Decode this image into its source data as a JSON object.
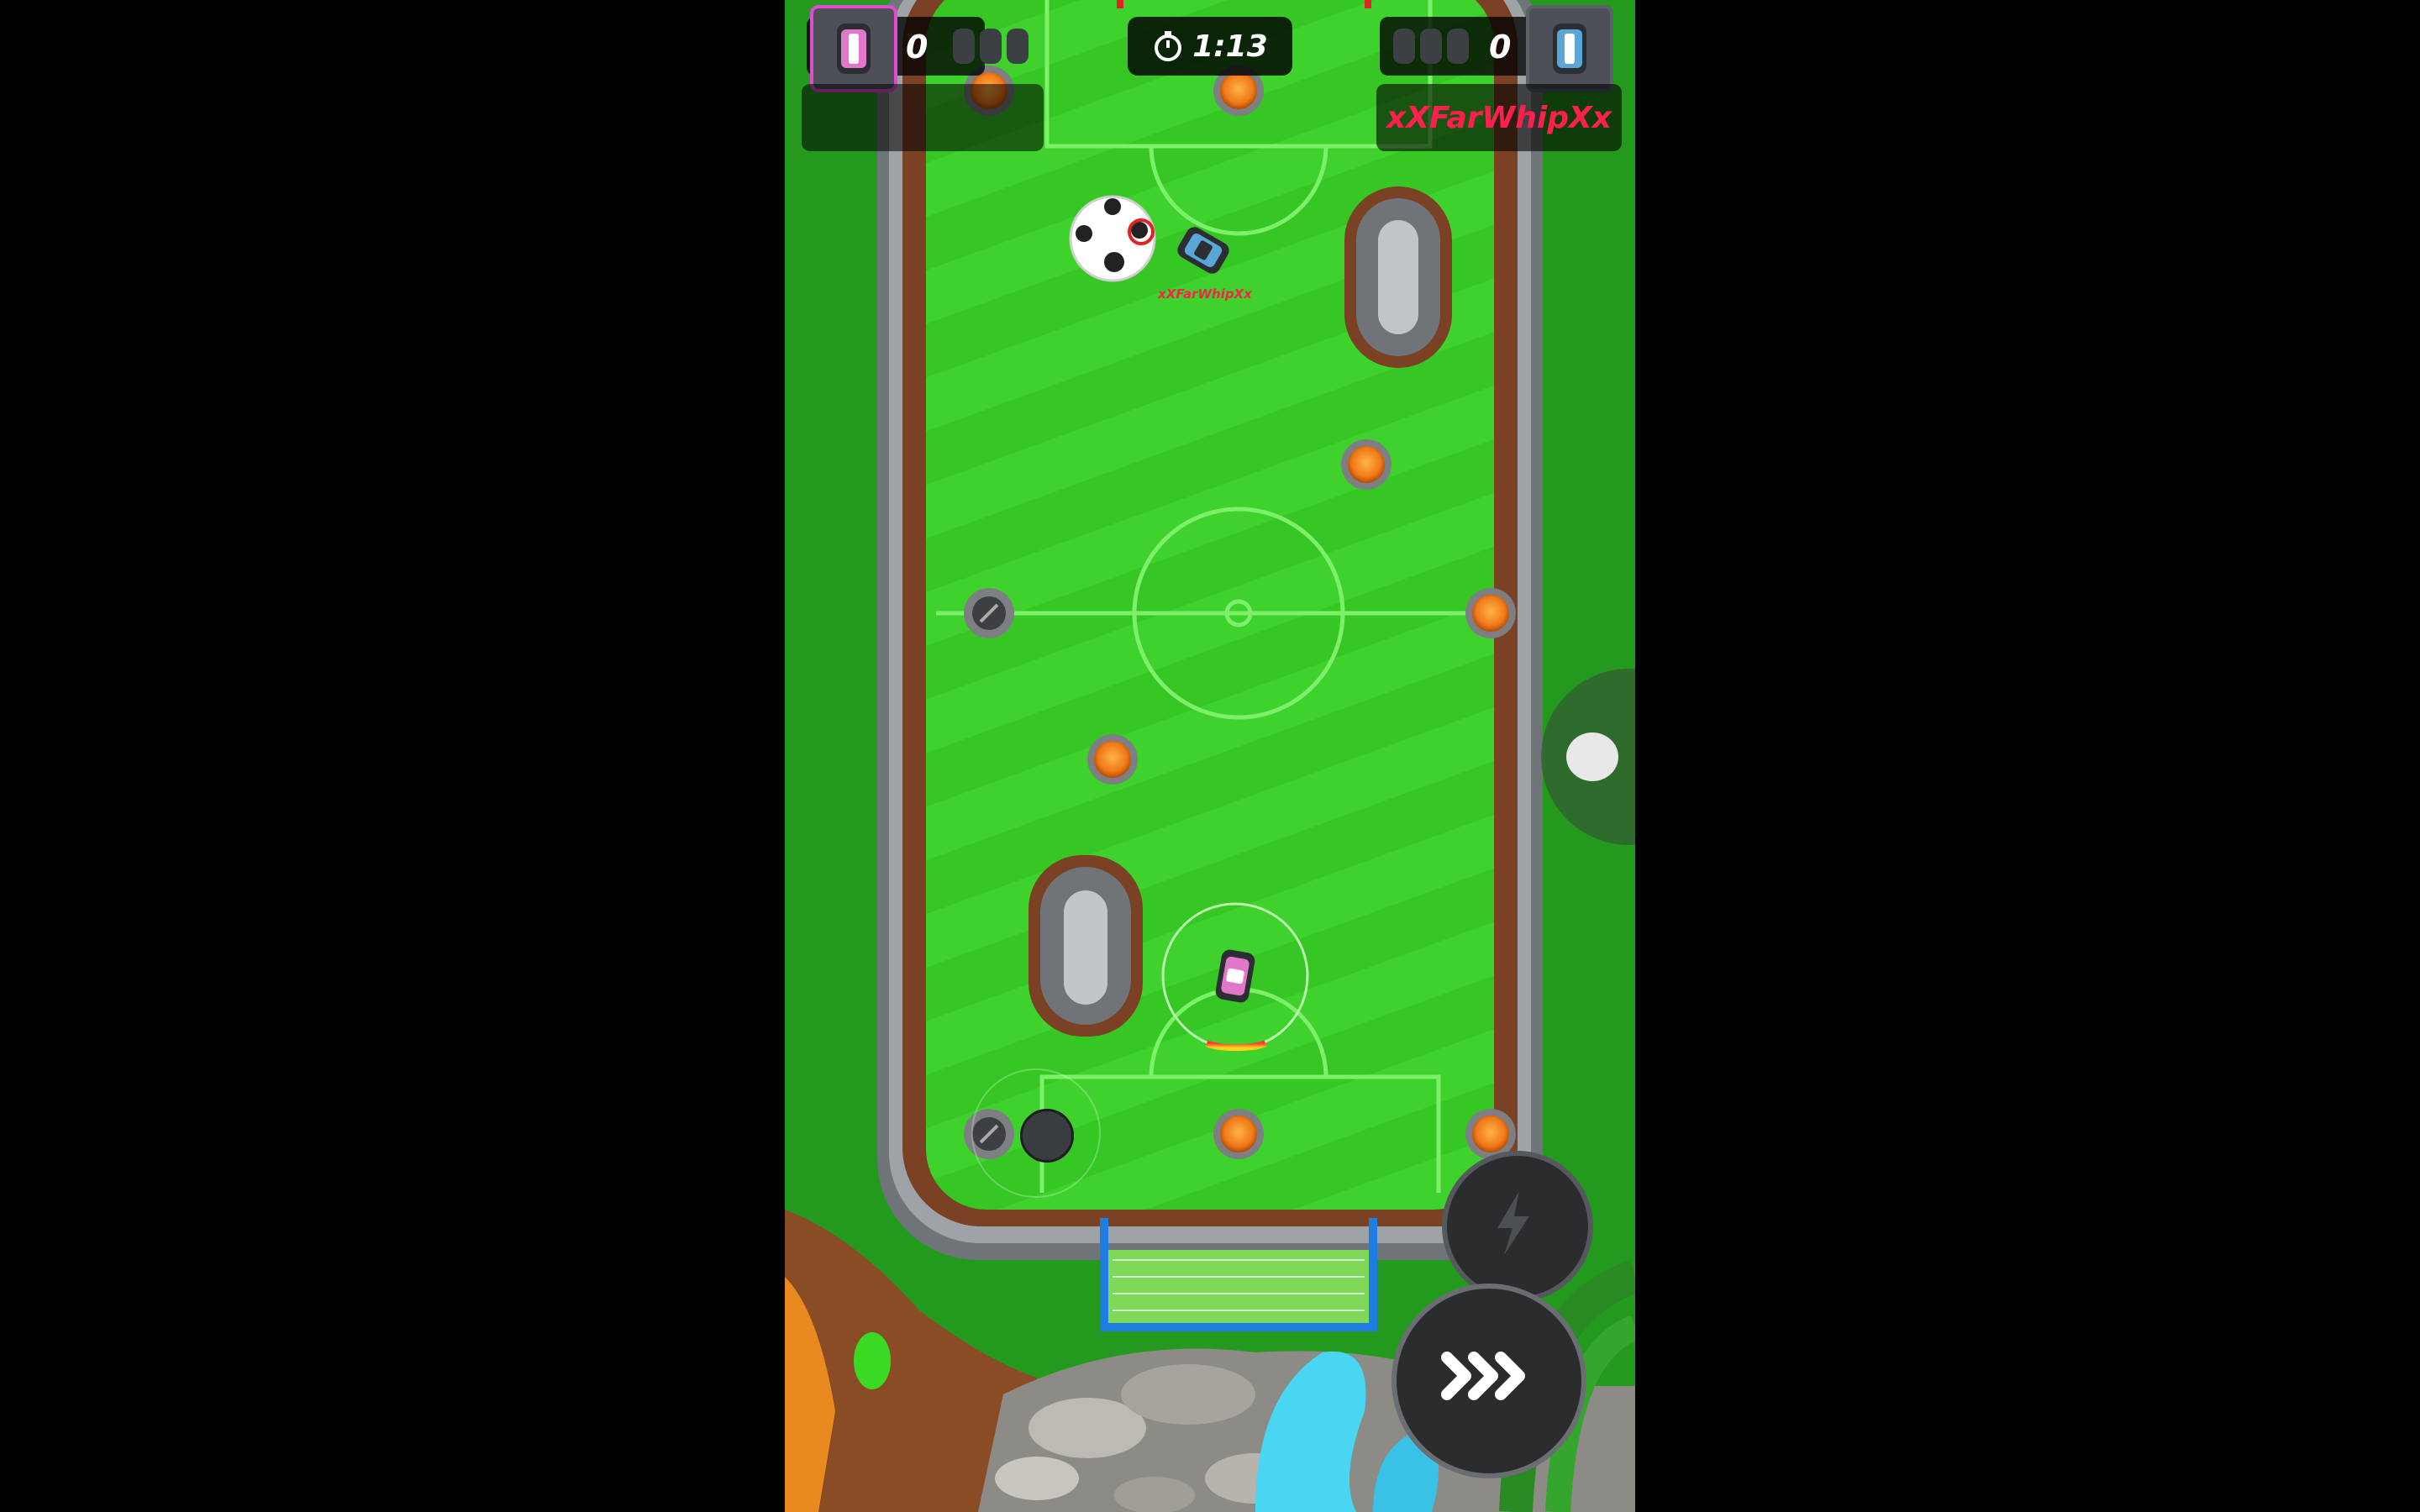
{
  "hud": {
    "left_player": {
      "score": "0",
      "pips": 3
    },
    "right_player": {
      "score": "0",
      "pips": 3,
      "name": "xXFarWhipXx"
    },
    "timer": "1:13"
  },
  "field": {
    "opponent_label": "xXFarWhipXx"
  },
  "controls": {
    "boost_icon": "lightning-icon",
    "dash_icon": "triple-chevron-icon",
    "chat_icon": "chat-bubble-icon"
  },
  "colors": {
    "grass": "#3cd12a",
    "opponent_name": "#ff1f4f",
    "player_frame": "#e04bd0",
    "opponent_frame": "#5a6168"
  }
}
